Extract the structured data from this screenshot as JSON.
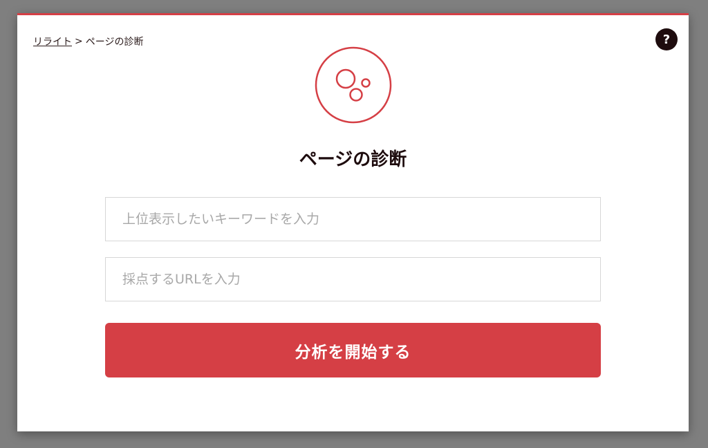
{
  "modal": {
    "breadcrumb": {
      "parent": "リライト",
      "separator": ">",
      "current": "ページの診断"
    },
    "help_label": "?",
    "icon": "bubbles-icon",
    "title": "ページの診断",
    "keyword_input": {
      "value": "",
      "placeholder": "上位表示したいキーワードを入力"
    },
    "url_input": {
      "value": "",
      "placeholder": "採点するURLを入力"
    },
    "submit_label": "分析を開始する"
  },
  "colors": {
    "accent": "#d53f45",
    "dark": "#1e0c0e",
    "overlay": "#7f7f7f",
    "placeholder": "#a8a8a8"
  }
}
